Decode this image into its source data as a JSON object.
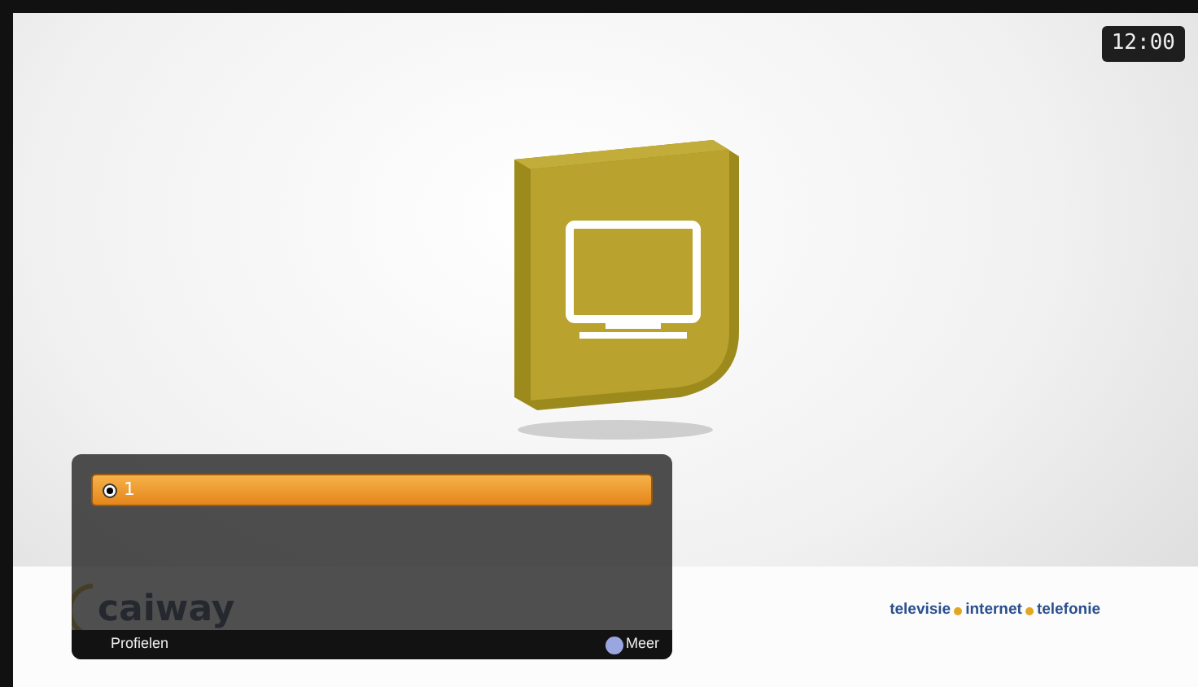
{
  "clock": "12:00",
  "branding": {
    "logo": "caiway",
    "tagline": [
      "televisie",
      "internet",
      "telefonie"
    ]
  },
  "profiles": [
    {
      "label": "1",
      "selected": true
    }
  ],
  "footer": {
    "left": "Profielen",
    "right": "Meer"
  }
}
